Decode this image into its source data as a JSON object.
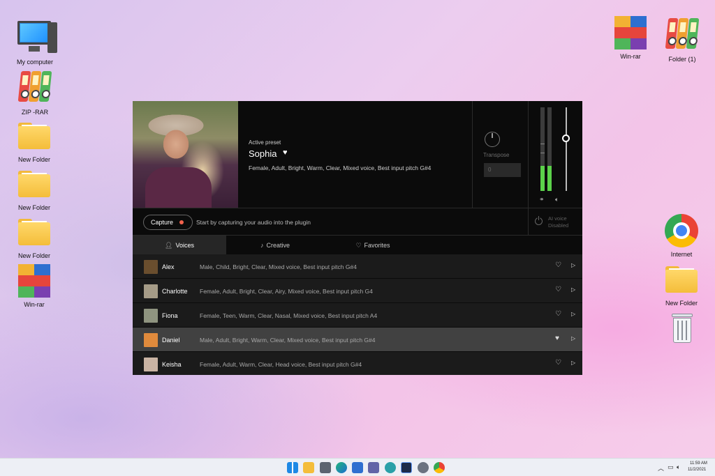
{
  "desktop": {
    "icons": [
      {
        "label": "My computer"
      },
      {
        "label": "ZIP -RAR"
      },
      {
        "label": "New Folder"
      },
      {
        "label": "New Folder"
      },
      {
        "label": "New Folder"
      },
      {
        "label": "Win-rar"
      },
      {
        "label": "Win-rar"
      },
      {
        "label": "Folder (1)"
      },
      {
        "label": "Internet"
      },
      {
        "label": "New Folder"
      }
    ]
  },
  "plugin": {
    "preset": {
      "caption": "Active preset",
      "name": "Sophia",
      "heart": "♥",
      "tags": "Female, Adult, Bright, Warm, Clear, Mixed voice, Best input pitch  G#4"
    },
    "transpose": {
      "label": "Transpose",
      "value": "0"
    },
    "meters": {
      "left_level": 0.3,
      "right_level": 0.3,
      "volume": 0.67
    },
    "capture": {
      "button_label": "Capture",
      "hint": "Start by capturing your audio into the plugin"
    },
    "ai_voice": {
      "line1": "AI voice",
      "line2": "Disabled"
    },
    "tabs": [
      {
        "label": "Voices",
        "icon": "person-icon",
        "active": true
      },
      {
        "label": "Creative",
        "icon": "music-note-icon",
        "active": false
      },
      {
        "label": "Favorites",
        "icon": "heart-icon",
        "active": false
      }
    ],
    "voices": [
      {
        "name": "Alex",
        "tags": "Male, Child, Bright, Clear, Mixed voice, Best input pitch G#4",
        "favorite": false,
        "color": "#6a4e2e"
      },
      {
        "name": "Charlotte",
        "tags": "Female, Adult, Bright, Clear, Airy, Mixed voice, Best input pitch  G4",
        "favorite": false,
        "color": "#a59b87"
      },
      {
        "name": "Fiona",
        "tags": "Female, Teen, Warm, Clear, Nasal, Mixed voice, Best input pitch  A4",
        "favorite": false,
        "color": "#8f9480"
      },
      {
        "name": "Daniel",
        "tags": "Male, Adult, Bright, Warm, Clear, Mixed voice, Best input pitch  G#4",
        "favorite": true,
        "color": "#e08a3c"
      },
      {
        "name": "Keisha",
        "tags": "Female, Adult, Warm, Clear, Head voice, Best input pitch  G#4",
        "favorite": false,
        "color": "#c9b3a3"
      }
    ]
  },
  "taskbar": {
    "time": "11:59 AM",
    "date": "11/2/2021"
  }
}
